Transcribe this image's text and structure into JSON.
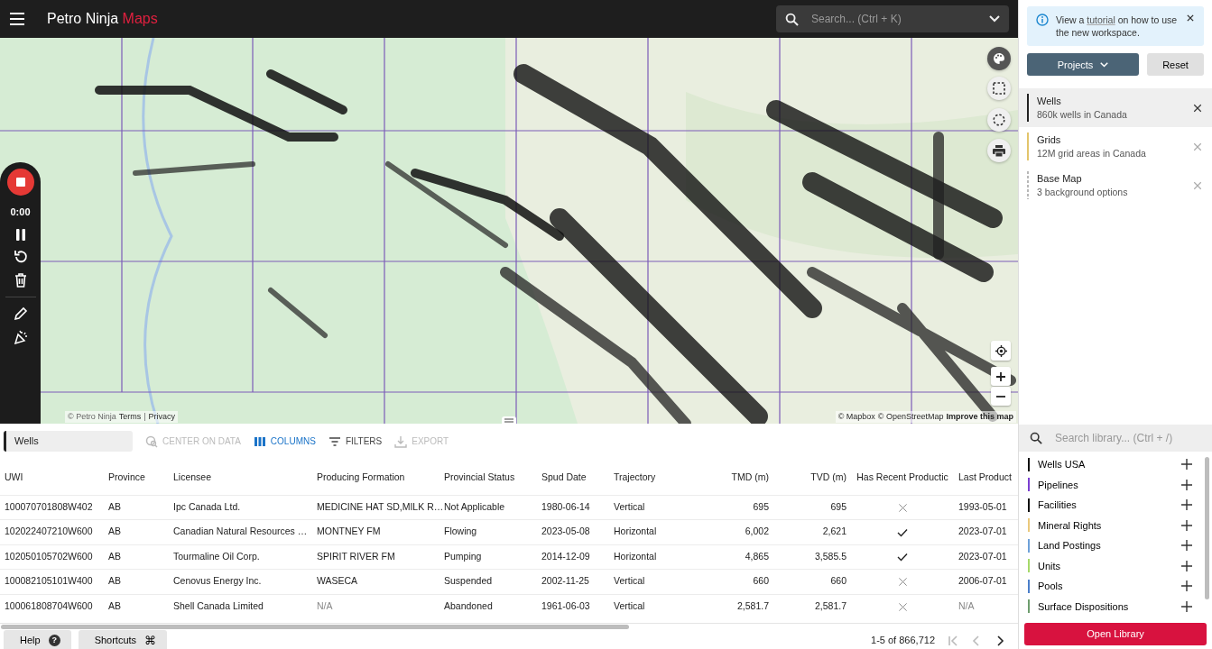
{
  "header": {
    "title": "Petro Ninja",
    "title_accent": "Maps",
    "search": {
      "placeholder": "Search... (Ctrl + K)"
    }
  },
  "map": {
    "kind": "picture",
    "recorder": {
      "time": "0:00"
    },
    "attribution_left": [
      {
        "text": "© Petro Ninja",
        "link": false
      },
      {
        "text": "Terms",
        "link": true
      },
      {
        "text": "|",
        "link": false
      },
      {
        "text": "Privacy",
        "link": true
      }
    ],
    "attribution_right": [
      {
        "text": "© Mapbox",
        "link": true
      },
      {
        "text": "© OpenStreetMap",
        "link": true
      },
      {
        "text": "Improve this map",
        "link": true
      }
    ]
  },
  "table": {
    "layer": "Wells",
    "actions": [
      {
        "kind": "center",
        "label": "CENTER ON DATA",
        "disabled": true,
        "active": false
      },
      {
        "kind": "columns",
        "label": "COLUMNS",
        "disabled": false,
        "active": true
      },
      {
        "kind": "filters",
        "label": "FILTERS",
        "disabled": false,
        "active": false
      },
      {
        "kind": "export",
        "label": "EXPORT",
        "disabled": true,
        "active": false
      }
    ],
    "columns": [
      "UWI",
      "Province",
      "Licensee",
      "Producing Formation",
      "Provincial Status",
      "Spud Date",
      "Trajectory",
      "TMD (m)",
      "TVD (m)",
      "Has Recent Productic",
      "Last Product"
    ],
    "rows": [
      {
        "uwi": "100070701808W402",
        "province": "AB",
        "licensee": "Ipc Canada Ltd.",
        "formation": "MEDICINE HAT SD,MILK R…",
        "formation_muted": false,
        "status": "Not Applicable",
        "spud": "1980-06-14",
        "trajectory": "Vertical",
        "tmd": "695",
        "tvd": "695",
        "recent": false,
        "last": "1993-05-01",
        "last_muted": false
      },
      {
        "uwi": "102022407210W600",
        "province": "AB",
        "licensee": "Canadian Natural Resources …",
        "formation": "MONTNEY FM",
        "formation_muted": false,
        "status": "Flowing",
        "spud": "2023-05-08",
        "trajectory": "Horizontal",
        "tmd": "6,002",
        "tvd": "2,621",
        "recent": true,
        "last": "2023-07-01",
        "last_muted": false
      },
      {
        "uwi": "102050105702W600",
        "province": "AB",
        "licensee": "Tourmaline Oil Corp.",
        "formation": "SPIRIT RIVER FM",
        "formation_muted": false,
        "status": "Pumping",
        "spud": "2014-12-09",
        "trajectory": "Horizontal",
        "tmd": "4,865",
        "tvd": "3,585.5",
        "recent": true,
        "last": "2023-07-01",
        "last_muted": false
      },
      {
        "uwi": "100082105101W400",
        "province": "AB",
        "licensee": "Cenovus Energy Inc.",
        "formation": "WASECA",
        "formation_muted": false,
        "status": "Suspended",
        "spud": "2002-11-25",
        "trajectory": "Vertical",
        "tmd": "660",
        "tvd": "660",
        "recent": false,
        "last": "2006-07-01",
        "last_muted": false
      },
      {
        "uwi": "100061808704W600",
        "province": "AB",
        "licensee": "Shell Canada Limited",
        "formation": "N/A",
        "formation_muted": true,
        "status": "Abandoned",
        "spud": "1961-06-03",
        "trajectory": "Vertical",
        "tmd": "2,581.7",
        "tvd": "2,581.7",
        "recent": false,
        "last": "N/A",
        "last_muted": true
      }
    ],
    "pagination": {
      "range": "1-5 of 866,712",
      "first_disabled": true,
      "prev_disabled": true,
      "next_disabled": false
    }
  },
  "footer_buttons": [
    {
      "kind": "help",
      "label": "Help",
      "glyph": "?"
    },
    {
      "kind": "shortcuts",
      "label": "Shortcuts",
      "glyph": "⌘"
    }
  ],
  "panel": {
    "notice": {
      "before": "View a",
      "link": "tutorial",
      "after": "on how to use the new workspace."
    },
    "projects_button": "Projects",
    "reset_button": "Reset",
    "layers": [
      {
        "name": "Wells",
        "detail": "860k wells in Canada",
        "color": "#222222",
        "kind": "solid",
        "selected": true
      },
      {
        "name": "Grids",
        "detail": "12M grid areas in Canada",
        "color": "#e3c56b",
        "kind": "solid",
        "selected": false
      },
      {
        "name": "Base Map",
        "detail": "3 background options",
        "color": "#b8b8b8",
        "kind": "dashed",
        "selected": false
      }
    ],
    "library_search": {
      "placeholder": "Search library... (Ctrl + /)"
    },
    "library": [
      {
        "name": "Wells USA",
        "color": "#111111"
      },
      {
        "name": "Pipelines",
        "color": "#7a3fd0"
      },
      {
        "name": "Facilities",
        "color": "#111111"
      },
      {
        "name": "Mineral Rights",
        "color": "#eac97c"
      },
      {
        "name": "Land Postings",
        "color": "#6ea1d9"
      },
      {
        "name": "Units",
        "color": "#a6d96a"
      },
      {
        "name": "Pools",
        "color": "#4b7fca"
      },
      {
        "name": "Surface Dispositions",
        "color": "#6e9e6e"
      }
    ],
    "open_library": "Open Library"
  }
}
